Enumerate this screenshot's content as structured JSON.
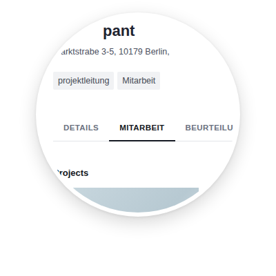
{
  "header": {
    "title": "pant",
    "address": "arktstrabe 3-5, 10179 Berlin,"
  },
  "tags": [
    "projektleitung",
    "Mitarbeit"
  ],
  "tabs": [
    {
      "label": "DETAILS",
      "selected": false
    },
    {
      "label": "MITARBEIT",
      "selected": true
    },
    {
      "label": "BEURTEILU",
      "selected": false
    }
  ],
  "projects": {
    "heading": "Projects"
  }
}
